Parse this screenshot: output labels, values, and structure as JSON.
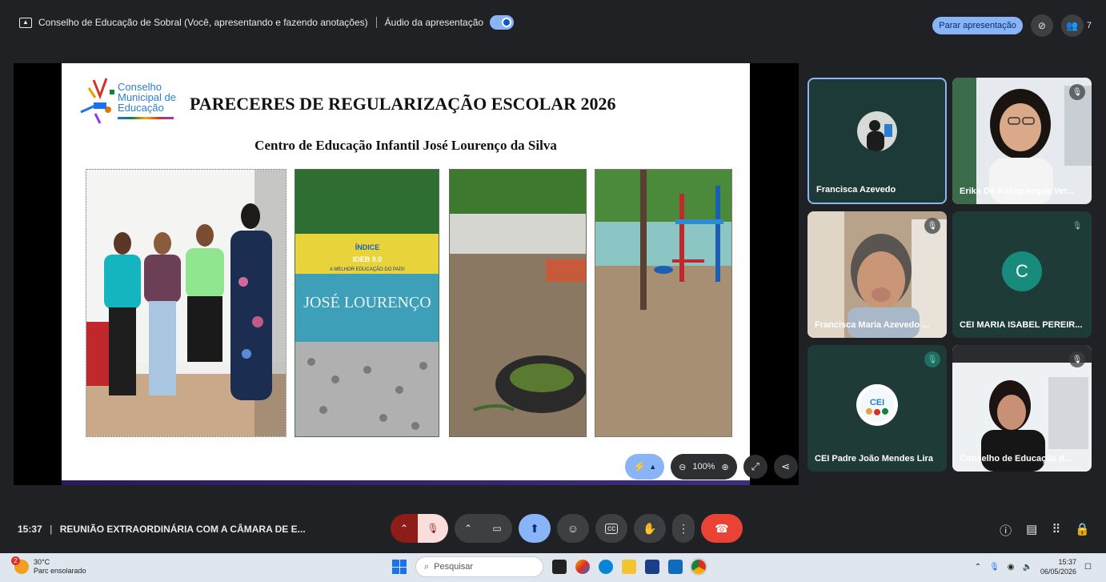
{
  "banner": {
    "text": "Conselho de Educação de Sobral (Você, apresentando e fazendo anotações)",
    "audio_label": "Áudio da apresentação",
    "stop_label": "Parar apresentação",
    "participant_count": "7"
  },
  "slide": {
    "logo_text": [
      "Conselho",
      "Municipal de",
      "Educação"
    ],
    "title": "PARECERES DE REGULARIZAÇÃO ESCOLAR 2026",
    "subtitle": "Centro de Educação Infantil José Lourenço da Silva",
    "banner_text_1": "ÍNDICE",
    "banner_text_2": "IDEB 9.0",
    "banner_text_3": "A MELHOR EDUCAÇÃO DO PAÍS!",
    "wall_text": "JOSÉ LOURENÇO"
  },
  "zoom": {
    "level": "100%"
  },
  "participants": [
    {
      "name": "Francisca Azevedo",
      "muted": false
    },
    {
      "name": "Erika De Albuquerque Ver...",
      "muted": true
    },
    {
      "name": "Francisca Maria Azevedo ...",
      "muted": true
    },
    {
      "name": "CEI MARIA ISABEL PEREIR...",
      "muted": true,
      "initial": "C"
    },
    {
      "name": "CEI Padre João Mendes Lira",
      "muted": true
    },
    {
      "name": "Conselho de Educação d...",
      "muted": true
    }
  ],
  "meeting": {
    "time": "15:37",
    "title": "REUNIÃO EXTRAORDINÁRIA COM A CÂMARA DE E..."
  },
  "taskbar": {
    "temp": "30°C",
    "weather": "Parc ensolarado",
    "weather_badge": "2",
    "search_placeholder": "Pesquisar",
    "time": "15:37",
    "date": "06/05/2026"
  },
  "colors": {
    "accent": "#8ab4f8",
    "end_call": "#ea4335",
    "mic_muted": "#f9dedc",
    "tile_bg": "#1f3b38",
    "active_border": "#8ab4f8"
  }
}
